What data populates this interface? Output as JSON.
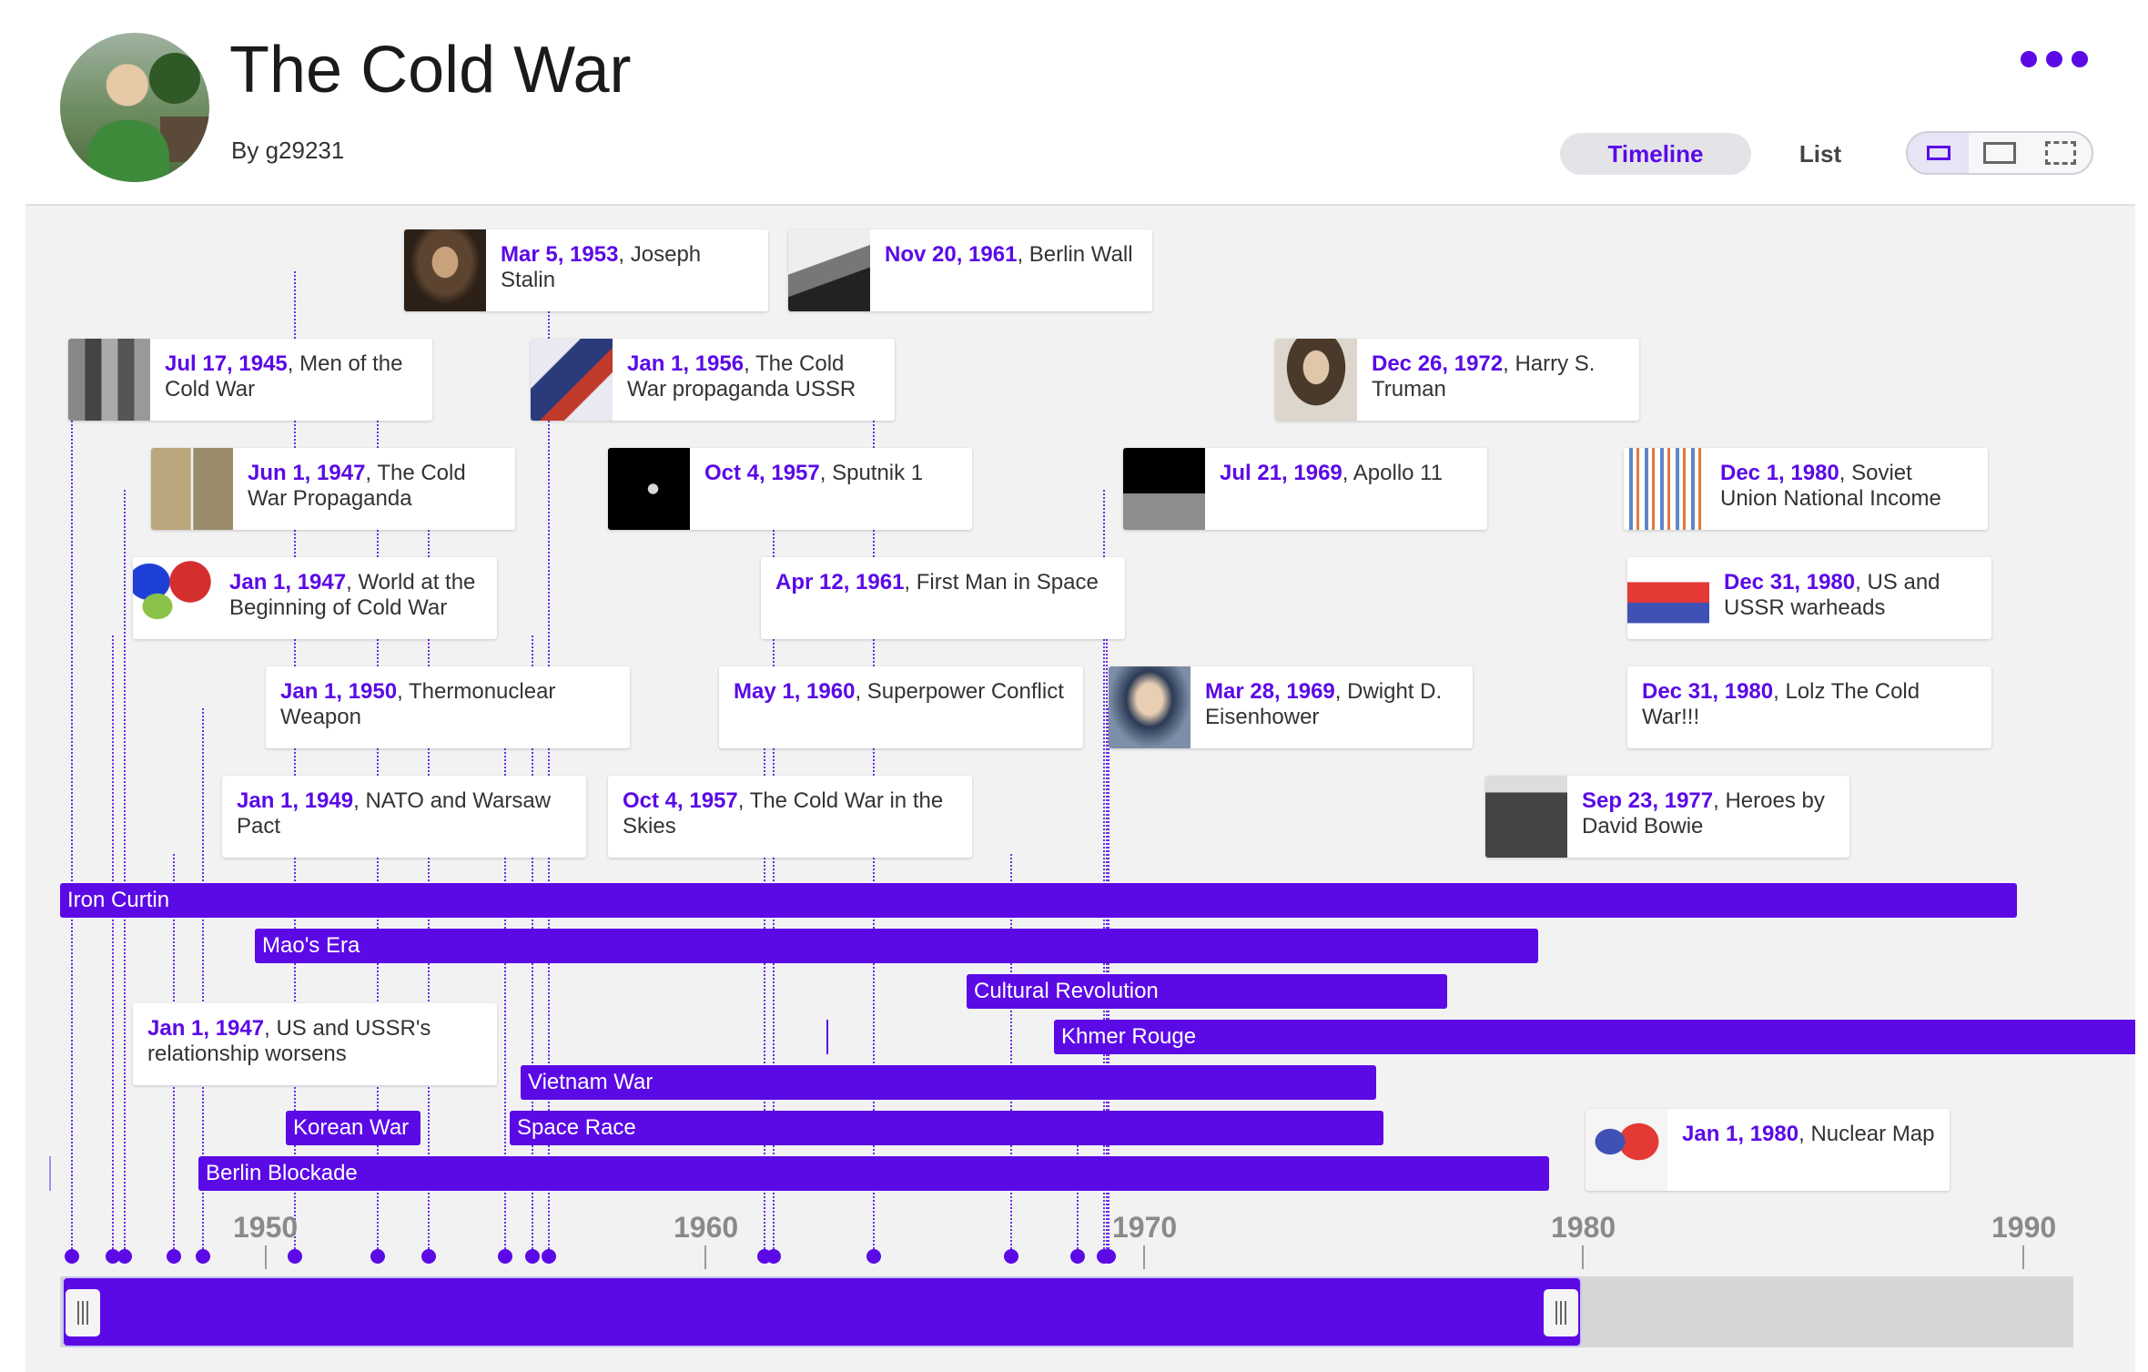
{
  "header": {
    "title": "The Cold War",
    "byline": "By g29231",
    "tabs": {
      "timeline": "Timeline",
      "list": "List"
    },
    "accent_color": "#5b0ae6"
  },
  "events": [
    {
      "date": "Mar 5, 1953",
      "title": ", Joseph Stalin",
      "icon": "stalin-photo"
    },
    {
      "date": "Nov 20, 1961",
      "title": ", Berlin Wall",
      "icon": "berlin-wall-photo"
    },
    {
      "date": "Jul 17, 1945",
      "title": ", Men of the Cold War",
      "icon": "men-photo"
    },
    {
      "date": "Jan 1, 1956",
      "title": ", The Cold War propaganda USSR",
      "icon": "propaganda-poster"
    },
    {
      "date": "Dec 26, 1972",
      "title": ", Harry S. Truman",
      "icon": "truman-photo"
    },
    {
      "date": "Jun 1, 1947",
      "title": ", The Cold War Propaganda",
      "icon": "propaganda-cartoon"
    },
    {
      "date": "Oct 4, 1957",
      "title": ", Sputnik 1",
      "icon": "sputnik-photo"
    },
    {
      "date": "Jul 21, 1969",
      "title": ", Apollo 11",
      "icon": "apollo-photo"
    },
    {
      "date": "Dec 1, 1980",
      "title": ", Soviet Union National Income",
      "icon": "income-chart"
    },
    {
      "date": "Jan 1, 1947",
      "title": ", World at the Beginning of Cold War",
      "icon": "world-map"
    },
    {
      "date": "Apr 12, 1961",
      "title": ", First Man in Space",
      "icon": ""
    },
    {
      "date": "Dec 31, 1980",
      "title": ", US and USSR warheads",
      "icon": "warheads-chart"
    },
    {
      "date": "Jan 1, 1950",
      "title": ", Thermonuclear Weapon",
      "icon": ""
    },
    {
      "date": "May 1, 1960",
      "title": ", Superpower Conflict",
      "icon": ""
    },
    {
      "date": "Mar 28, 1969",
      "title": ", Dwight D. Eisenhower",
      "icon": "eisenhower-photo"
    },
    {
      "date": "Dec 31, 1980",
      "title": ", Lolz The Cold War!!!",
      "icon": ""
    },
    {
      "date": "Jan 1, 1949",
      "title": ", NATO and Warsaw Pact",
      "icon": ""
    },
    {
      "date": "Oct 4, 1957",
      "title": ", The Cold War in the Skies",
      "icon": ""
    },
    {
      "date": "Sep 23, 1977",
      "title": ", Heroes by David Bowie",
      "icon": "bowie-photo"
    },
    {
      "date": "Jan 1, 1947",
      "title": ", US and USSR's relationship worsens",
      "icon": ""
    },
    {
      "date": "Jan 1, 1980",
      "title": ", Nuclear Map",
      "icon": "nuclear-map"
    }
  ],
  "spans": [
    {
      "label": "Iron Curtin"
    },
    {
      "label": "Mao's Era"
    },
    {
      "label": "Cultural Revolution"
    },
    {
      "label": "Khmer Rouge"
    },
    {
      "label": "Vietnam War"
    },
    {
      "label": "Korean War"
    },
    {
      "label": "Space Race"
    },
    {
      "label": "Berlin Blockade"
    }
  ],
  "axis": {
    "ticks": [
      "1950",
      "1960",
      "1970",
      "1980",
      "1990"
    ]
  }
}
